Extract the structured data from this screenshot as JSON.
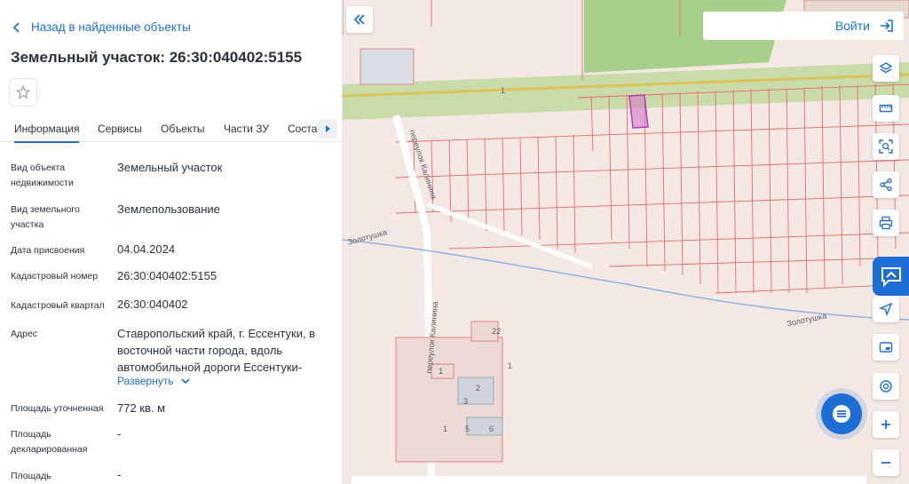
{
  "panel": {
    "back_label": "Назад в найденные объекты",
    "title": "Земельный участок: 26:30:040402:5155",
    "tabs": [
      {
        "label": "Информация",
        "active": true
      },
      {
        "label": "Сервисы"
      },
      {
        "label": "Объекты"
      },
      {
        "label": "Части ЗУ"
      },
      {
        "label": "Состав"
      }
    ],
    "fields": [
      {
        "label": "Вид объекта недвижимости",
        "value": "Земельный участок"
      },
      {
        "label": "Вид земельного участка",
        "value": "Землепользование"
      },
      {
        "label": "Дата присвоения",
        "value": "04.04.2024"
      },
      {
        "label": "Кадастровый номер",
        "value": "26:30:040402:5155"
      },
      {
        "label": "Кадастровый квартал",
        "value": "26:30:040402"
      },
      {
        "label": "Адрес",
        "value": "Ставропольский край, г. Ессентуки, в восточной части города, вдоль автомобильной дороги Ессентуки-"
      },
      {
        "label": "Площадь уточненная",
        "value": "772 кв. м"
      },
      {
        "label": "Площадь декларированная",
        "value": "-"
      },
      {
        "label": "Площадь",
        "value": "-"
      }
    ],
    "expand_label": "Развернуть"
  },
  "map": {
    "login_label": "Войти",
    "street_labels": [
      "переулок Калинина",
      "переулок Калинина",
      "Золотушка",
      "Золотушка"
    ],
    "numbers": [
      "1",
      "22",
      "1",
      "3",
      "2",
      "1",
      "5",
      "6",
      "1"
    ]
  },
  "colors": {
    "accent": "#1d6fd6",
    "parcel_line": "#e86a6a",
    "selected_parcel": "#b040b0",
    "road_green": "#a6cf8a"
  }
}
